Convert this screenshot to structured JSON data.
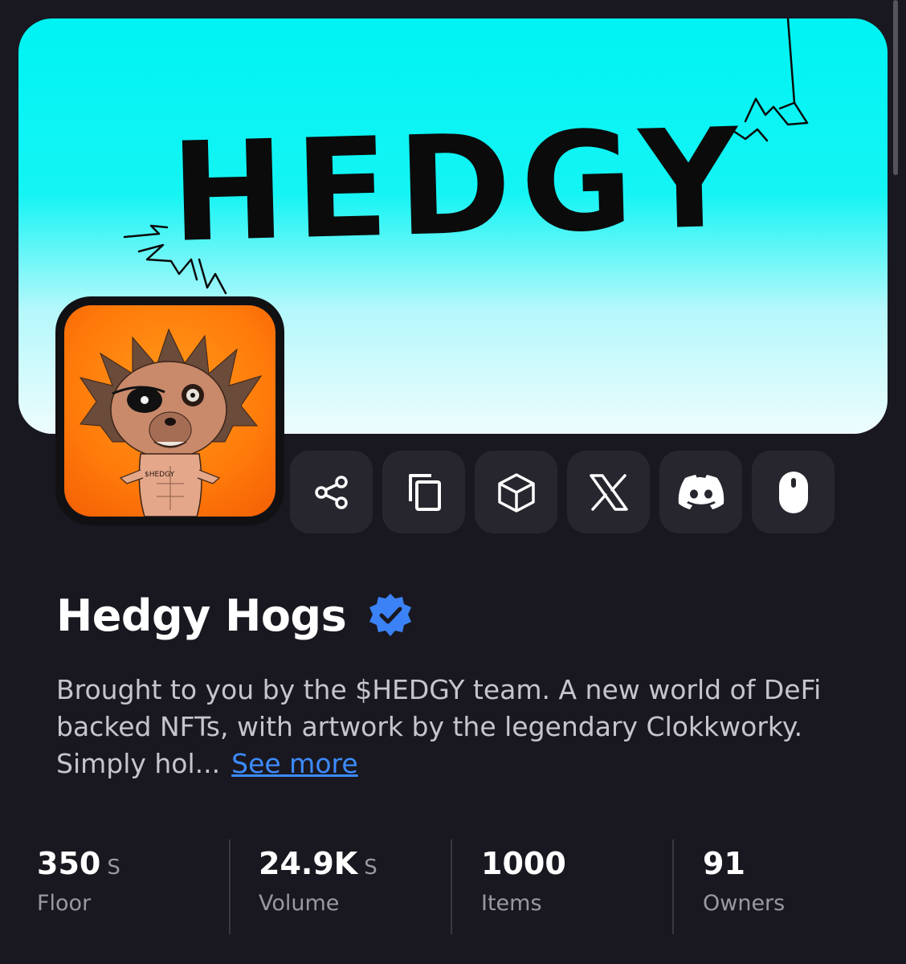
{
  "banner": {
    "wordmark": "HEDGY",
    "background_top": "#00f3f3",
    "background_bottom": "#eefcfd"
  },
  "avatar": {
    "alt": "Hedgy hog avatar",
    "badge_text": "$HEDGY",
    "background": "#ff7a0a"
  },
  "actions": [
    {
      "icon": "share-icon"
    },
    {
      "icon": "copy-icon"
    },
    {
      "icon": "cube-icon"
    },
    {
      "icon": "x-logo-icon"
    },
    {
      "icon": "discord-icon"
    },
    {
      "icon": "mouse-icon"
    }
  ],
  "collection": {
    "name": "Hedgy Hogs",
    "verified": true,
    "verified_color": "#3b82f6",
    "description": "Brought to you by the $HEDGY team. A new world of DeFi backed NFTs, with artwork by the legendary Clokkworky. Simply hol...",
    "see_more_label": "See more"
  },
  "stats": [
    {
      "value": "350",
      "unit": "S",
      "label": "Floor"
    },
    {
      "value": "24.9K",
      "unit": "S",
      "label": "Volume"
    },
    {
      "value": "1000",
      "unit": "",
      "label": "Items"
    },
    {
      "value": "91",
      "unit": "",
      "label": "Owners"
    }
  ]
}
